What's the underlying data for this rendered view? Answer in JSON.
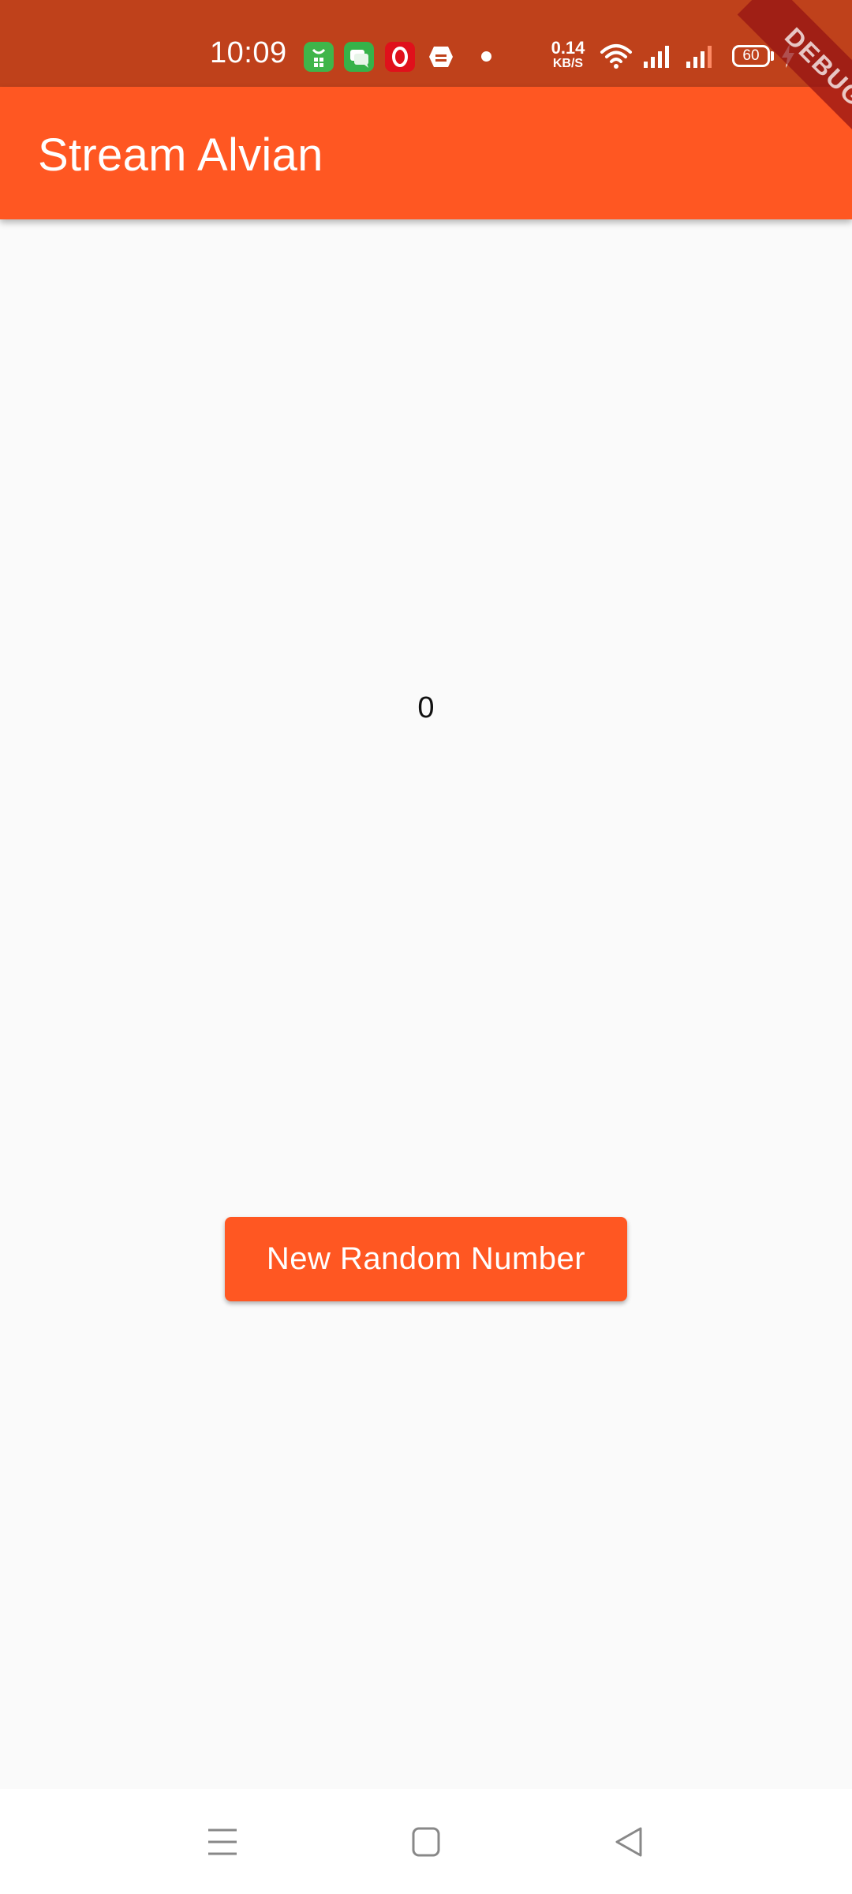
{
  "status_bar": {
    "time": "10:09",
    "net_speed_value": "0.14",
    "net_speed_unit": "KB/S",
    "battery_level": "60",
    "notification_icons": [
      "shopping-app-icon",
      "messages-icon",
      "opera-icon",
      "bank-app-icon"
    ],
    "system_icons": [
      "wifi-icon",
      "cellular-signal-1-icon",
      "cellular-signal-2-icon",
      "battery-icon",
      "charging-icon"
    ],
    "background_color": "#bf411b"
  },
  "app_bar": {
    "title": "Stream Alvian",
    "color": "#ff5722"
  },
  "debug_banner": {
    "label": "DEBUG"
  },
  "main": {
    "counter_value": "0",
    "button_label": "New Random Number",
    "button_color": "#ff5722"
  },
  "nav_bar": {
    "buttons": [
      "menu-icon",
      "home-icon",
      "back-icon"
    ]
  }
}
